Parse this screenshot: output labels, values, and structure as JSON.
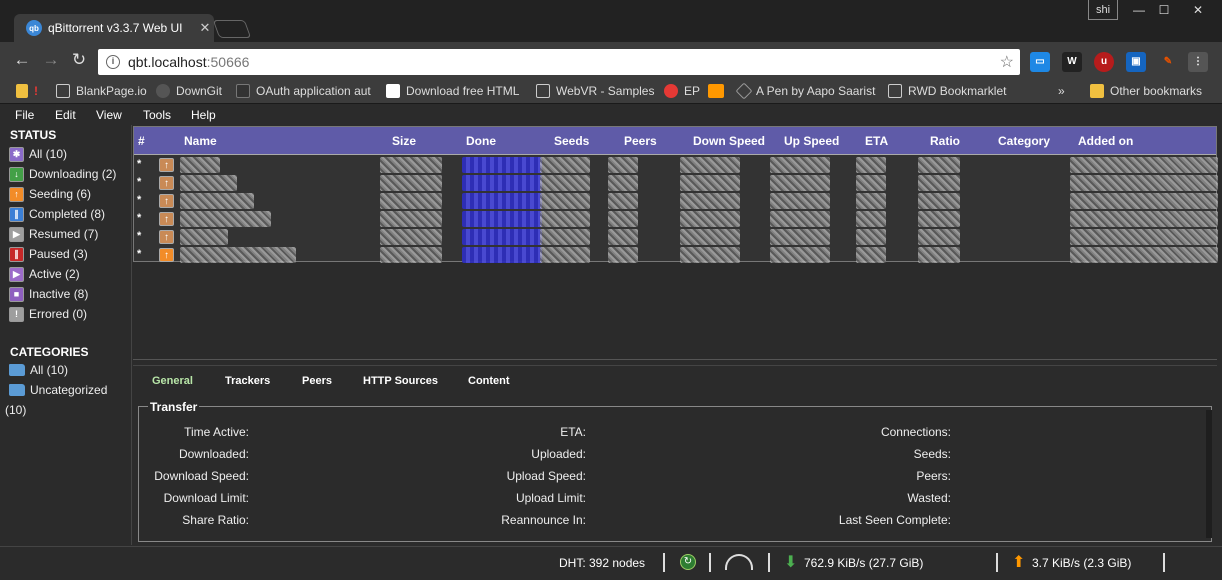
{
  "browser": {
    "tab_title": "qBittorrent v3.3.7 Web UI",
    "favicon": "qb",
    "profile": "shi",
    "url_host": "qbt.localhost",
    "url_port": ":50666",
    "bookmarks": [
      "BlankPage.io",
      "DownGit",
      "OAuth application aut",
      "Download free HTML",
      "WebVR - Samples",
      "EP",
      "A Pen by Aapo Saarist",
      "RWD Bookmarklet"
    ],
    "other_bookmarks": "Other bookmarks"
  },
  "menu": [
    "File",
    "Edit",
    "View",
    "Tools",
    "Help"
  ],
  "sidebar": {
    "status_heading": "STATUS",
    "status": [
      {
        "label": "All (10)",
        "color": "#8a6bc9",
        "glyph": "✱"
      },
      {
        "label": "Downloading (2)",
        "color": "#43a047",
        "glyph": "↓"
      },
      {
        "label": "Seeding (6)",
        "color": "#f28c28",
        "glyph": "↑"
      },
      {
        "label": "Completed (8)",
        "color": "#3b7fd6",
        "glyph": "∥"
      },
      {
        "label": "Resumed (7)",
        "color": "#9e9e9e",
        "glyph": "▶"
      },
      {
        "label": "Paused (3)",
        "color": "#c62828",
        "glyph": "∥"
      },
      {
        "label": "Active (2)",
        "color": "#9c6bc9",
        "glyph": "▶"
      },
      {
        "label": "Inactive (8)",
        "color": "#8e5fbf",
        "glyph": "■"
      },
      {
        "label": "Errored (0)",
        "color": "#9e9e9e",
        "glyph": "!"
      }
    ],
    "categories_heading": "CATEGORIES",
    "categories": [
      "All (10)",
      "Uncategorized"
    ],
    "categories_overflow": "(10)"
  },
  "table": {
    "columns": [
      "#",
      "Name",
      "Size",
      "Done",
      "Seeds",
      "Peers",
      "Down Speed",
      "Up Speed",
      "ETA",
      "Ratio",
      "Category",
      "Added on"
    ],
    "rows": [
      "*",
      "*",
      "*",
      "*",
      "*",
      "*"
    ]
  },
  "panel_tabs": [
    "General",
    "Trackers",
    "Peers",
    "HTTP Sources",
    "Content"
  ],
  "transfer": {
    "legend": "Transfer",
    "col1": [
      "Time Active:",
      "Downloaded:",
      "Download Speed:",
      "Download Limit:",
      "Share Ratio:"
    ],
    "col2": [
      "ETA:",
      "Uploaded:",
      "Upload Speed:",
      "Upload Limit:",
      "Reannounce In:"
    ],
    "col3": [
      "Connections:",
      "Seeds:",
      "Peers:",
      "Wasted:",
      "Last Seen Complete:"
    ]
  },
  "status": {
    "dht": "DHT: 392 nodes",
    "down": "762.9 KiB/s (27.7 GiB)",
    "up": "3.7 KiB/s (2.3 GiB)"
  }
}
